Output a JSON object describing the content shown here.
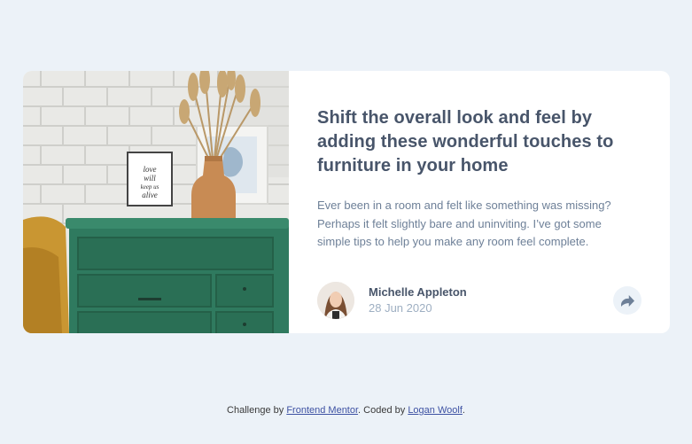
{
  "article": {
    "title": "Shift the overall look and feel by adding these wonderful touches to furniture in your home",
    "excerpt": "Ever been in a room and felt like something was missing? Perhaps it felt slightly bare and uninviting. I’ve got some simple tips to help you make any room feel complete.",
    "image_alt": "drawers",
    "frame_text": "love will keep us alive"
  },
  "author": {
    "name": "Michelle Appleton",
    "date": "28 Jun 2020"
  },
  "share": {
    "icon": "share-icon"
  },
  "attribution": {
    "prefix": "Challenge by ",
    "link1": "Frontend Mentor",
    "middle": ". Coded by ",
    "link2": "Logan Woolf",
    "suffix": "."
  },
  "colors": {
    "background": "#ecf2f8",
    "card": "#ffffff",
    "title": "#48556a",
    "body_text": "#6e8098",
    "muted": "#9eafc2",
    "share_bg": "#ecf2f8",
    "link": "#3e52a3"
  }
}
